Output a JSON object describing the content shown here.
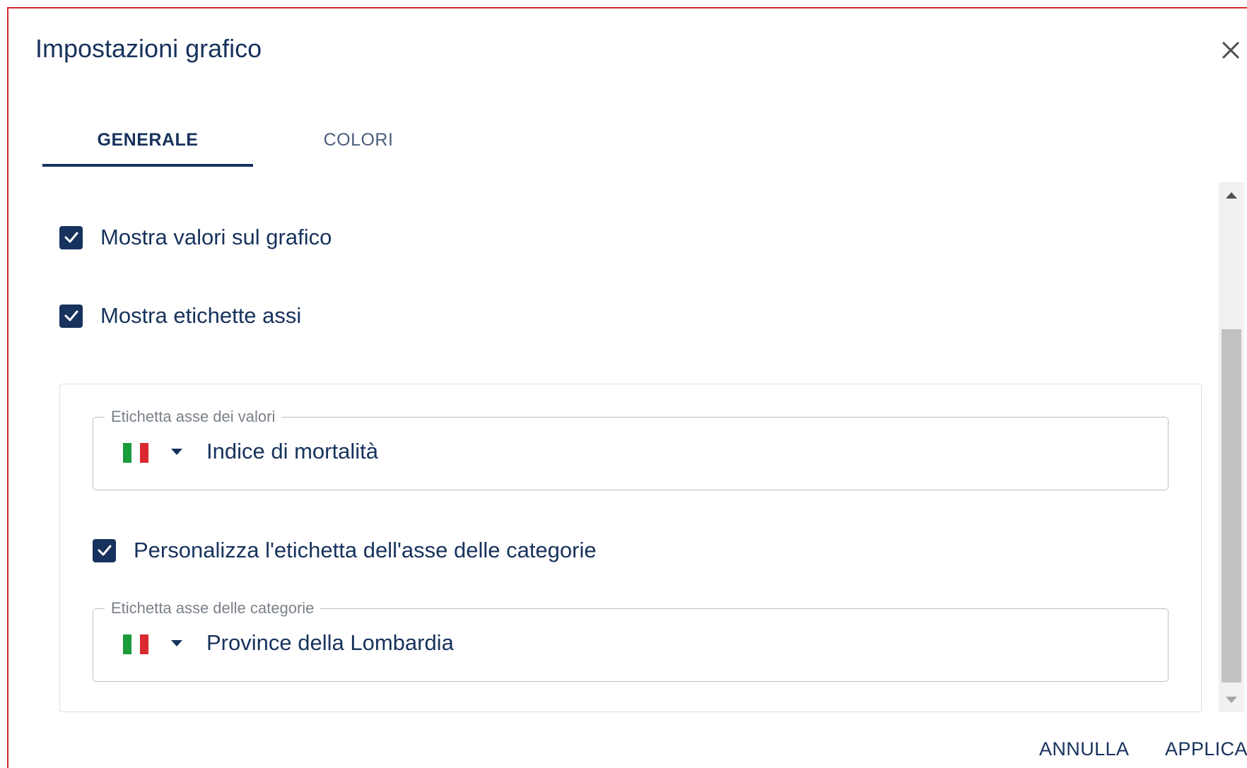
{
  "dialog": {
    "title": "Impostazioni grafico",
    "accent_color": "#17325c",
    "border_color": "#d9272e"
  },
  "icons": {
    "close": "close-icon",
    "check": "check-icon",
    "flag": "italy-flag-icon",
    "caret": "caret-down-icon"
  },
  "tabs": [
    {
      "label": "GENERALE",
      "active": true
    },
    {
      "label": "COLORI",
      "active": false
    }
  ],
  "options": {
    "show_values": {
      "label": "Mostra valori sul grafico",
      "checked": true
    },
    "show_axis_labels": {
      "label": "Mostra etichette assi",
      "checked": true
    },
    "customize_category_label": {
      "label": "Personalizza l'etichetta dell'asse delle categorie",
      "checked": true
    }
  },
  "value_axis_field": {
    "legend": "Etichetta asse dei valori",
    "value": "Indice di mortalità",
    "language": "it"
  },
  "category_axis_field": {
    "legend": "Etichetta asse delle categorie",
    "value": "Province della Lombardia",
    "language": "it"
  },
  "footer": {
    "cancel_label": "ANNULLA",
    "apply_label": "APPLICA"
  }
}
